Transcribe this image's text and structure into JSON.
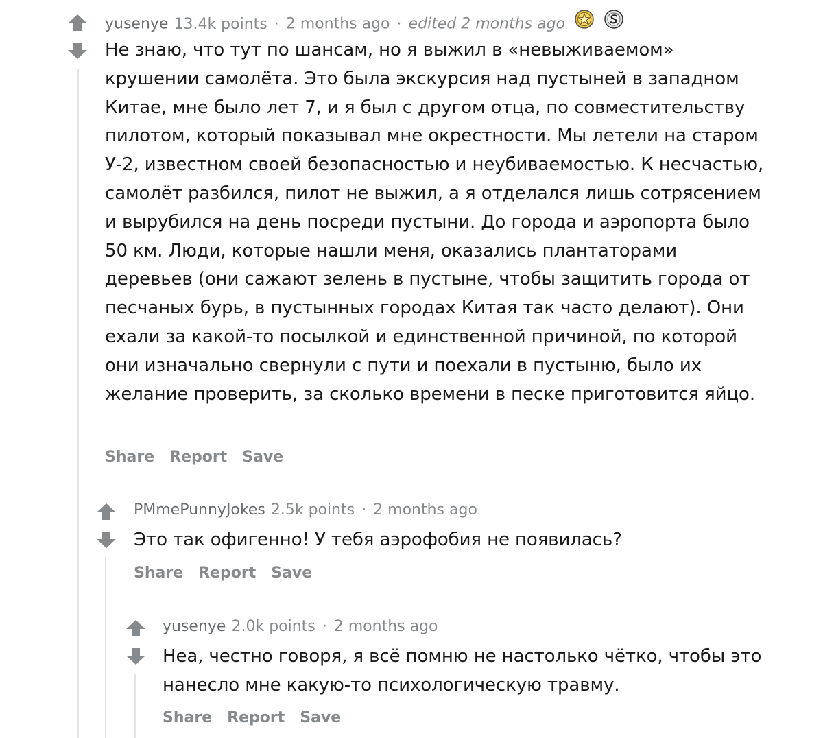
{
  "comments": [
    {
      "author": "yusenye",
      "points": "13.4k points",
      "time": "2 months ago",
      "edited": "edited 2 months ago",
      "awards": [
        "gold-star-award-icon",
        "silver-award-icon"
      ],
      "body": "Не знаю, что тут по шансам, но я выжил в «невыживаемом» крушении самолёта. Это была экскурсия над пустыней в западном Китае, мне было лет 7, и я был с другом отца, по совместительству пилотом, который показывал мне окрестности. Мы летели на старом У-2, известном своей безопасностью и неубиваемостью. К несчастью, самолёт разбился, пилот не выжил, а я отделался лишь сотрясением и вырубился на день посреди пустыни. До города и аэропорта было 50 км. Люди, которые нашли меня, оказались плантаторами деревьев (они сажают зелень в пустыне, чтобы защитить города от песчаных бурь, в пустынных городах Китая так часто делают). Они ехали за какой-то посылкой и единственной причиной, по которой они изначально свернули с пути и поехали в пустыню, было их желание проверить, за сколько времени в песке приготовится яйцо.",
      "actions": [
        "Share",
        "Report",
        "Save"
      ]
    },
    {
      "author": "PMmePunnyJokes",
      "points": "2.5k points",
      "time": "2 months ago",
      "body": "Это так офигенно! У тебя аэрофобия не появилась?",
      "actions": [
        "Share",
        "Report",
        "Save"
      ]
    },
    {
      "author": "yusenye",
      "points": "2.0k points",
      "time": "2 months ago",
      "body": "Неа, честно говоря, я всё помню не настолько чётко, чтобы это нанесло мне какую-то психологическую травму.",
      "actions": [
        "Share",
        "Report",
        "Save"
      ]
    }
  ],
  "separator": "·",
  "colors": {
    "meta": "#878a8c",
    "text": "#1a1a1b",
    "arrow": "#878a8c",
    "thread": "#e4e4e4"
  }
}
